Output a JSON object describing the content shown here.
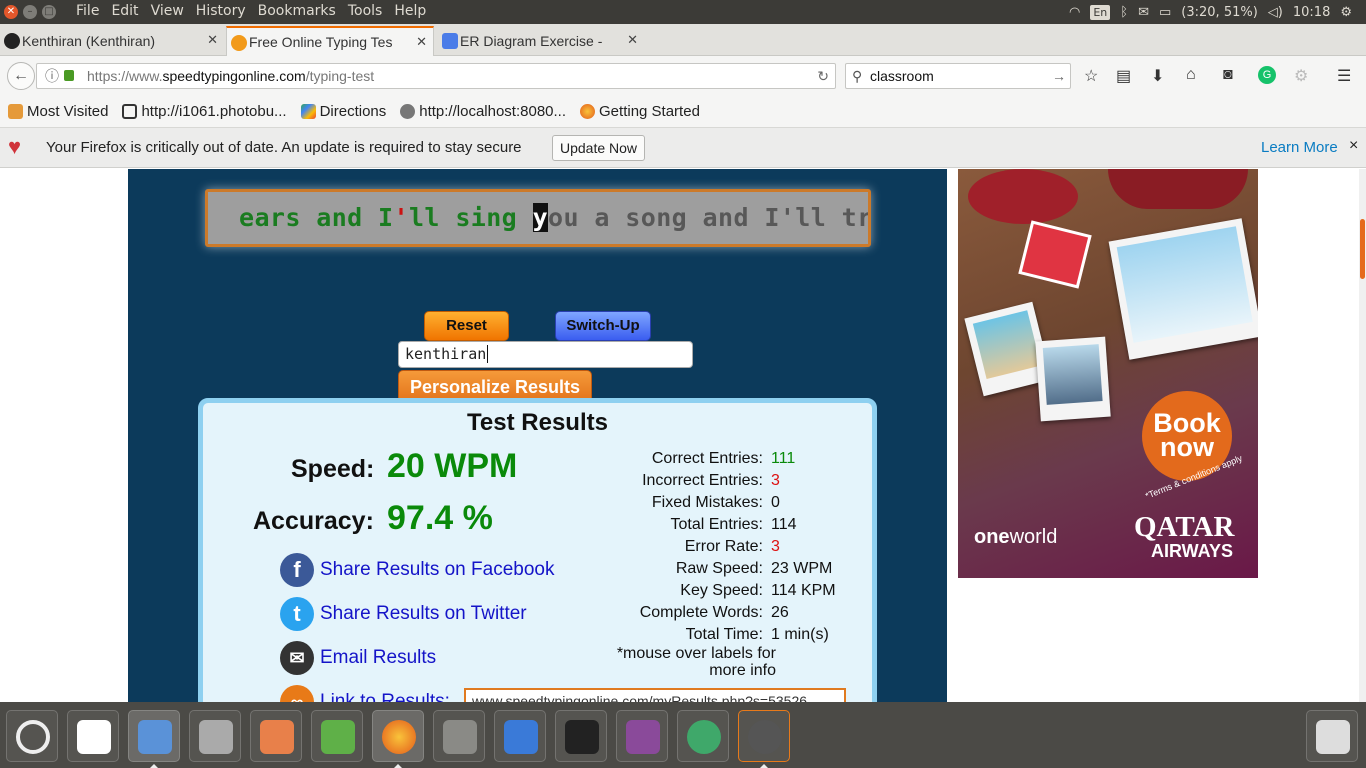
{
  "topbar": {
    "menu": [
      "File",
      "Edit",
      "View",
      "History",
      "Bookmarks",
      "Tools",
      "Help"
    ],
    "keyboard": "En",
    "battery": "(3:20, 51%)",
    "clock": "10:18"
  },
  "tabs": [
    {
      "label": "Kenthiran (Kenthiran)",
      "icon": "github-icon",
      "active": false
    },
    {
      "label": "Free Online Typing Tes",
      "icon": "speedtyping-icon",
      "active": true
    },
    {
      "label": "ER Diagram Exercise -",
      "icon": "docs-icon",
      "active": false
    }
  ],
  "nav": {
    "url_prefix": "https://www.",
    "url_domain": "speedtypingonline.com",
    "url_path": "/typing-test",
    "search_value": "classroom"
  },
  "bookmarks": [
    {
      "label": "Most Visited",
      "icon": "folder-icon"
    },
    {
      "label": "http://i1061.photobu...",
      "icon": "photobucket-icon"
    },
    {
      "label": "Directions",
      "icon": "maps-icon"
    },
    {
      "label": "http://localhost:8080...",
      "icon": "globe-icon"
    },
    {
      "label": "Getting Started",
      "icon": "firefox-icon"
    }
  ],
  "notification": {
    "message": "Your Firefox is critically out of date. An update is required to stay secure",
    "update_button": "Update Now",
    "learn_more": "Learn More",
    "close": "×"
  },
  "typing": {
    "typed_correct_1": "ears and I",
    "typed_error": "'",
    "typed_correct_2": "ll sing ",
    "cursor_char": "y",
    "remaining": "ou a song and I'll tr"
  },
  "controls": {
    "reset": "Reset",
    "switch_up": "Switch-Up",
    "name_value": "kenthiran",
    "personalize": "Personalize Results"
  },
  "results": {
    "title": "Test Results",
    "speed_label": "Speed:",
    "speed_value": "20 WPM",
    "accuracy_label": "Accuracy:",
    "accuracy_value": "97.4 %",
    "stats": [
      {
        "label": "Correct Entries:",
        "value": "111",
        "color": "#0a8a0a"
      },
      {
        "label": "Incorrect Entries:",
        "value": "3",
        "color": "#d11111"
      },
      {
        "label": "Fixed Mistakes:",
        "value": "0",
        "color": "#111111"
      },
      {
        "label": "Total Entries:",
        "value": "114",
        "color": "#111111"
      },
      {
        "label": "Error Rate:",
        "value": "3",
        "color": "#d11111"
      },
      {
        "label": "Raw Speed:",
        "value": "23 WPM",
        "color": "#111111"
      },
      {
        "label": "Key Speed:",
        "value": "114 KPM",
        "color": "#111111"
      },
      {
        "label": "Complete Words:",
        "value": "26",
        "color": "#111111"
      },
      {
        "label": "Total Time:",
        "value": "1 min(s)",
        "color": "#111111"
      }
    ],
    "note": "*mouse over labels for more info",
    "share_facebook": "Share Results on Facebook",
    "share_twitter": "Share Results on Twitter",
    "email": "Email Results",
    "link_label": "Link to Results:",
    "link_value": "www.speedtypingonline.com/myResults.php?s=53526"
  },
  "ad": {
    "book": "Book",
    "now": "now",
    "terms": "*Terms & conditions apply",
    "oneworld_bold": "one",
    "oneworld_rest": "world",
    "qatar": "QATAR",
    "airways": "AIRWAYS"
  },
  "taskbar": [
    "ubuntu-dash-icon",
    "evince-icon",
    "image-viewer-icon",
    "camera-icon",
    "impress-icon",
    "calc-icon",
    "firefox-icon",
    "files-icon",
    "compass-icon",
    "terminal-icon",
    "workspace-icon",
    "atom-icon",
    "software-updater-icon",
    "trash-icon"
  ]
}
